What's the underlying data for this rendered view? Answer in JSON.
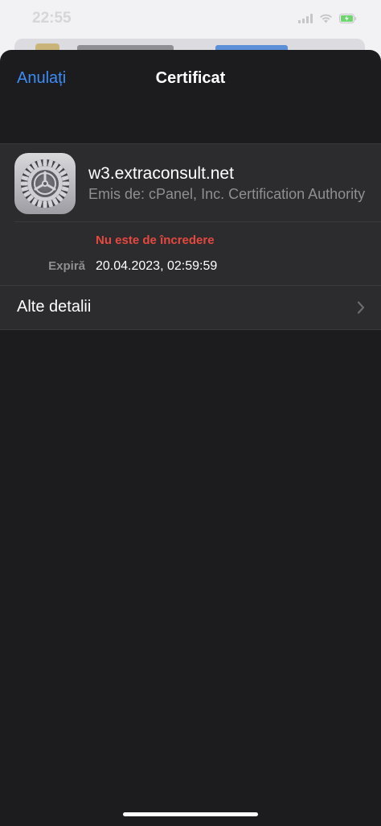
{
  "status_bar": {
    "time": "22:55"
  },
  "nav": {
    "cancel_label": "Anulați",
    "title": "Certificat"
  },
  "certificate": {
    "icon": "settings-gear-icon",
    "name": "w3.extraconsult.net",
    "issuer": "Emis de: cPanel, Inc. Certification Authority",
    "trust_status": "Nu este de încredere",
    "expiry_label": "Expiră",
    "expiry_value": "20.04.2023, 02:59:59"
  },
  "more_details": {
    "label": "Alte detalii"
  },
  "colors": {
    "accent": "#3d8cf6",
    "danger": "#e5483f",
    "sheet_background": "#1c1c1e",
    "group_background": "#2c2c2e"
  }
}
